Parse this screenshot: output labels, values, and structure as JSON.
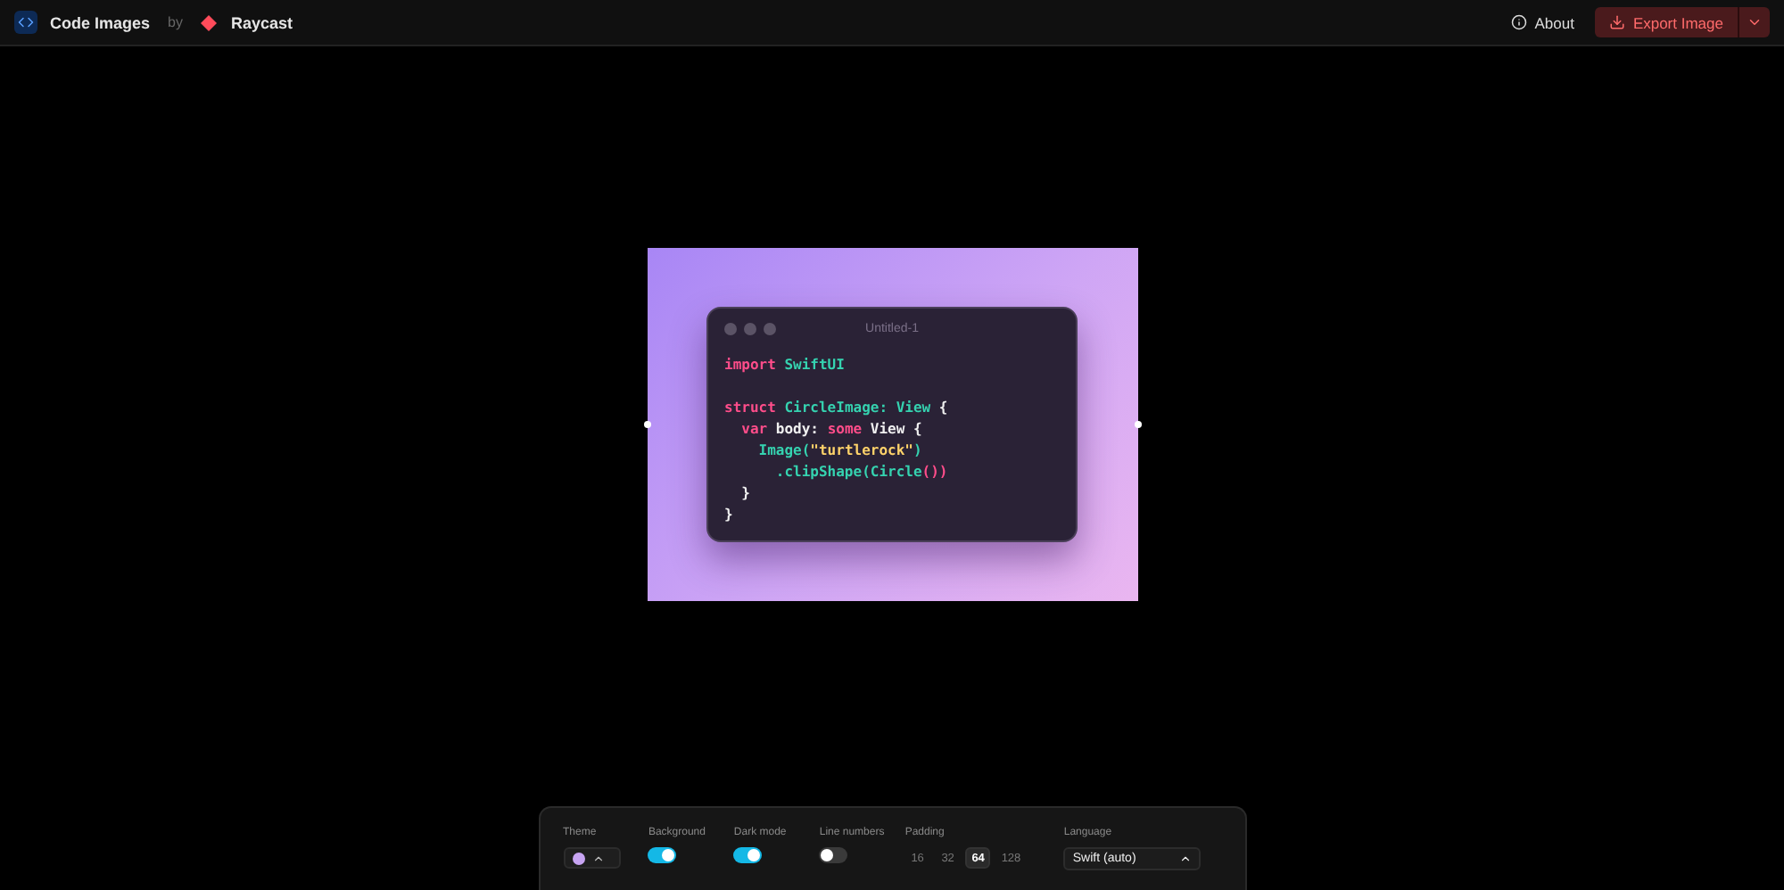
{
  "header": {
    "app_name": "Code Images",
    "by": "by",
    "brand": "Raycast",
    "about": "About",
    "export": "Export Image"
  },
  "code_window": {
    "title": "Untitled-1",
    "lines": [
      {
        "kind": "code",
        "tokens": [
          {
            "t": "import",
            "kind": "keyword"
          },
          {
            "t": " SwiftUI",
            "kind": "type"
          }
        ]
      },
      {
        "kind": "blank"
      },
      {
        "kind": "code",
        "tokens": [
          {
            "t": "struct",
            "kind": "keyword"
          },
          {
            "t": " CircleImage: View",
            "kind": "type"
          },
          {
            "t": " {",
            "kind": "plain"
          }
        ]
      },
      {
        "kind": "code",
        "tokens": [
          {
            "t": "  var",
            "kind": "keyword"
          },
          {
            "t": " body: ",
            "kind": "plain"
          },
          {
            "t": "some",
            "kind": "keyword"
          },
          {
            "t": " View {",
            "kind": "plain"
          }
        ]
      },
      {
        "kind": "code",
        "tokens": [
          {
            "t": "    Image(",
            "kind": "type"
          },
          {
            "t": "\"turtlerock\"",
            "kind": "string"
          },
          {
            "t": ")",
            "kind": "type"
          }
        ]
      },
      {
        "kind": "code",
        "tokens": [
          {
            "t": "      .clipShape(Circle",
            "kind": "type"
          },
          {
            "t": "())",
            "kind": "keyword"
          }
        ]
      },
      {
        "kind": "code",
        "tokens": [
          {
            "t": "  }",
            "kind": "plain"
          }
        ]
      },
      {
        "kind": "code",
        "tokens": [
          {
            "t": "}",
            "kind": "plain"
          }
        ]
      }
    ]
  },
  "controls": [
    {
      "kind": "theme",
      "label": "Theme",
      "color": "#c7a4f2"
    },
    {
      "kind": "toggle",
      "label": "Background",
      "on": true
    },
    {
      "kind": "toggle",
      "label": "Dark mode",
      "on": true
    },
    {
      "kind": "toggle",
      "label": "Line numbers",
      "on": false
    },
    {
      "kind": "padding",
      "label": "Padding",
      "options": [
        {
          "label": "16",
          "selected": false
        },
        {
          "label": "32",
          "selected": false
        },
        {
          "label": "64",
          "selected": true
        },
        {
          "label": "128",
          "selected": false
        }
      ]
    },
    {
      "kind": "select",
      "label": "Language",
      "value": "Swift (auto)"
    }
  ]
}
